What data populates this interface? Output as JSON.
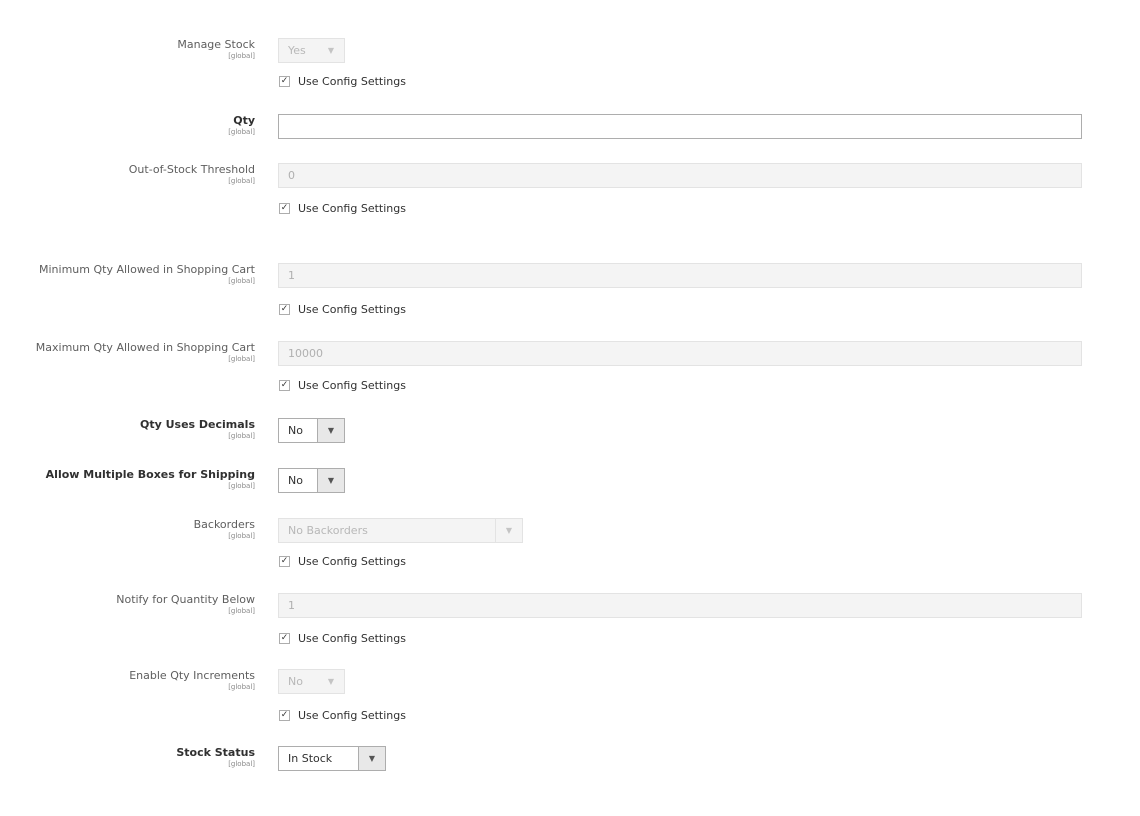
{
  "scope_label": "[global]",
  "use_config_label": "Use Config Settings",
  "fields": {
    "manage_stock": {
      "label": "Manage Stock",
      "value": "Yes",
      "use_config": true
    },
    "qty": {
      "label": "Qty",
      "value": ""
    },
    "out_of_stock_threshold": {
      "label": "Out-of-Stock Threshold",
      "value": "0",
      "use_config": true
    },
    "min_qty_cart": {
      "label": "Minimum Qty Allowed in Shopping Cart",
      "value": "1",
      "use_config": true
    },
    "max_qty_cart": {
      "label": "Maximum Qty Allowed in Shopping Cart",
      "value": "10000",
      "use_config": true
    },
    "qty_uses_decimals": {
      "label": "Qty Uses Decimals",
      "value": "No"
    },
    "allow_multiple_boxes": {
      "label": "Allow Multiple Boxes for Shipping",
      "value": "No"
    },
    "backorders": {
      "label": "Backorders",
      "value": "No Backorders",
      "use_config": true
    },
    "notify_qty_below": {
      "label": "Notify for Quantity Below",
      "value": "1",
      "use_config": true
    },
    "enable_qty_increments": {
      "label": "Enable Qty Increments",
      "value": "No",
      "use_config": true
    },
    "stock_status": {
      "label": "Stock Status",
      "value": "In Stock"
    }
  },
  "icons": {
    "dropdown": "▼",
    "check": "✓"
  }
}
